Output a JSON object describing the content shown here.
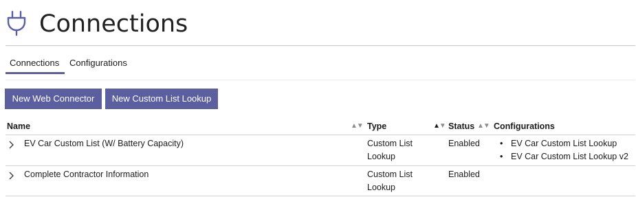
{
  "header": {
    "title": "Connections",
    "icon": "plug-icon",
    "accent": "#5c5f9f"
  },
  "tabs": [
    {
      "label": "Connections",
      "active": true
    },
    {
      "label": "Configurations",
      "active": false
    }
  ],
  "toolbar": {
    "new_web_connector_label": "New Web Connector",
    "new_custom_list_lookup_label": "New Custom List Lookup"
  },
  "table": {
    "columns": {
      "name": "Name",
      "type": "Type",
      "status": "Status",
      "configurations": "Configurations"
    },
    "rows": [
      {
        "name": "EV Car Custom List (W/ Battery Capacity)",
        "type_line1": "Custom List",
        "type_line2": "Lookup",
        "status": "Enabled",
        "configurations": [
          "EV Car Custom List Lookup",
          "EV Car Custom List Lookup v2"
        ]
      },
      {
        "name": "Complete Contractor Information",
        "type_line1": "Custom List",
        "type_line2": "Lookup",
        "status": "Enabled",
        "configurations": []
      }
    ]
  }
}
